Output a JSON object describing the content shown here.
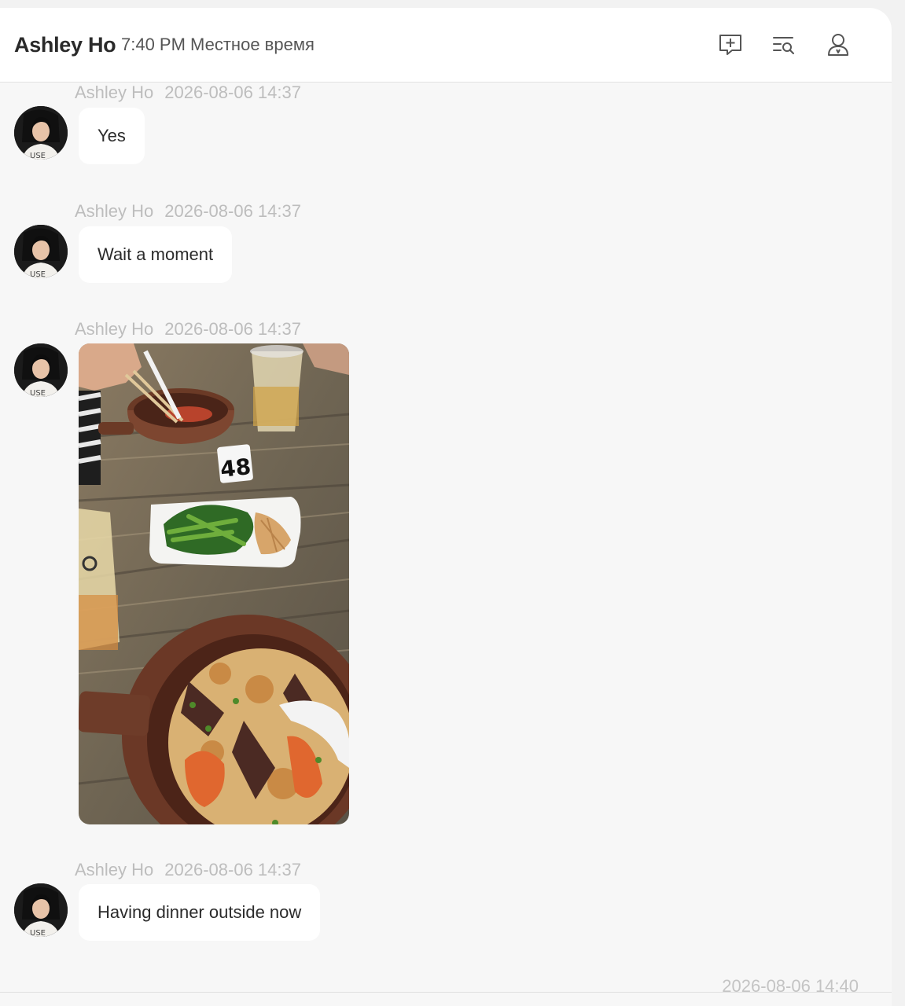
{
  "header": {
    "contact_name": "Ashley Ho",
    "local_time": "7:40 PM Местное время",
    "icons": [
      "new-message-icon",
      "search-history-icon",
      "profile-icon"
    ]
  },
  "messages": [
    {
      "sender": "Ashley Ho",
      "timestamp": "2026-08-06 14:37",
      "type": "text",
      "text": "Yes"
    },
    {
      "sender": "Ashley Ho",
      "timestamp": "2026-08-06 14:37",
      "type": "text",
      "text": "Wait a moment"
    },
    {
      "sender": "Ashley Ho",
      "timestamp": "2026-08-06 14:37",
      "type": "image",
      "image_number": "48"
    },
    {
      "sender": "Ashley Ho",
      "timestamp": "2026-08-06 14:37",
      "type": "text",
      "text": "Having dinner outside now"
    }
  ],
  "footer": {
    "timestamp": "2026-08-06 14:40"
  },
  "colors": {
    "background": "#f7f7f7",
    "bubble": "#ffffff",
    "meta_text": "#bdbdbd",
    "icon": "#555555"
  }
}
